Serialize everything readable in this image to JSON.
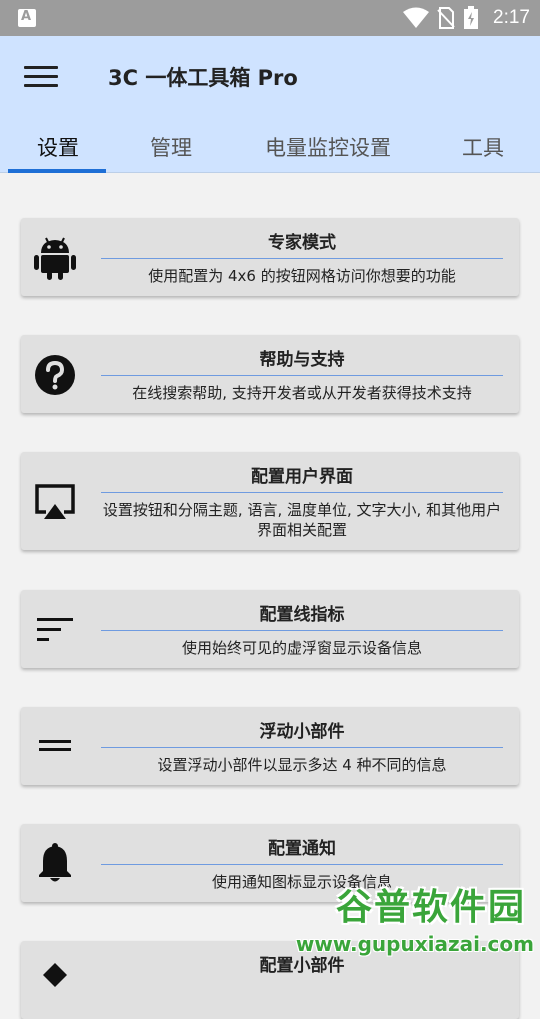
{
  "status_bar": {
    "time": "2:17"
  },
  "app_bar": {
    "title": "3C 一体工具箱 Pro"
  },
  "tabs": [
    {
      "label": "设置",
      "active": true
    },
    {
      "label": "管理",
      "active": false
    },
    {
      "label": "电量监控设置",
      "active": false
    },
    {
      "label": "工具",
      "active": false
    }
  ],
  "cards": [
    {
      "icon": "android-icon",
      "title": "专家模式",
      "description": "使用配置为 4x6 的按钮网格访问你想要的功能"
    },
    {
      "icon": "help-circle-icon",
      "title": "帮助与支持",
      "description": "在线搜索帮助, 支持开发者或从开发者获得技术支持"
    },
    {
      "icon": "cast-screen-icon",
      "title": "配置用户界面",
      "description": "设置按钮和分隔主题, 语言, 温度单位, 文字大小, 和其他用户界面相关配置"
    },
    {
      "icon": "sort-lines-icon",
      "title": "配置线指标",
      "description": "使用始终可见的虚浮窗显示设备信息"
    },
    {
      "icon": "double-line-icon",
      "title": "浮动小部件",
      "description": "设置浮动小部件以显示多达 4 种不同的信息"
    },
    {
      "icon": "bell-icon",
      "title": "配置通知",
      "description": "使用通知图标显示设备信息"
    },
    {
      "icon": "widget-icon",
      "title": "配置小部件",
      "description": ""
    }
  ],
  "watermark": {
    "line1": "谷普软件园",
    "line2": "www.gupuxiazai.com"
  },
  "colors": {
    "app_bar": "#cfe3ff",
    "tab_indicator": "#1e6fd6",
    "card": "#e0e0e0",
    "divider": "#6f9be0",
    "watermark": "#3aa53a"
  }
}
